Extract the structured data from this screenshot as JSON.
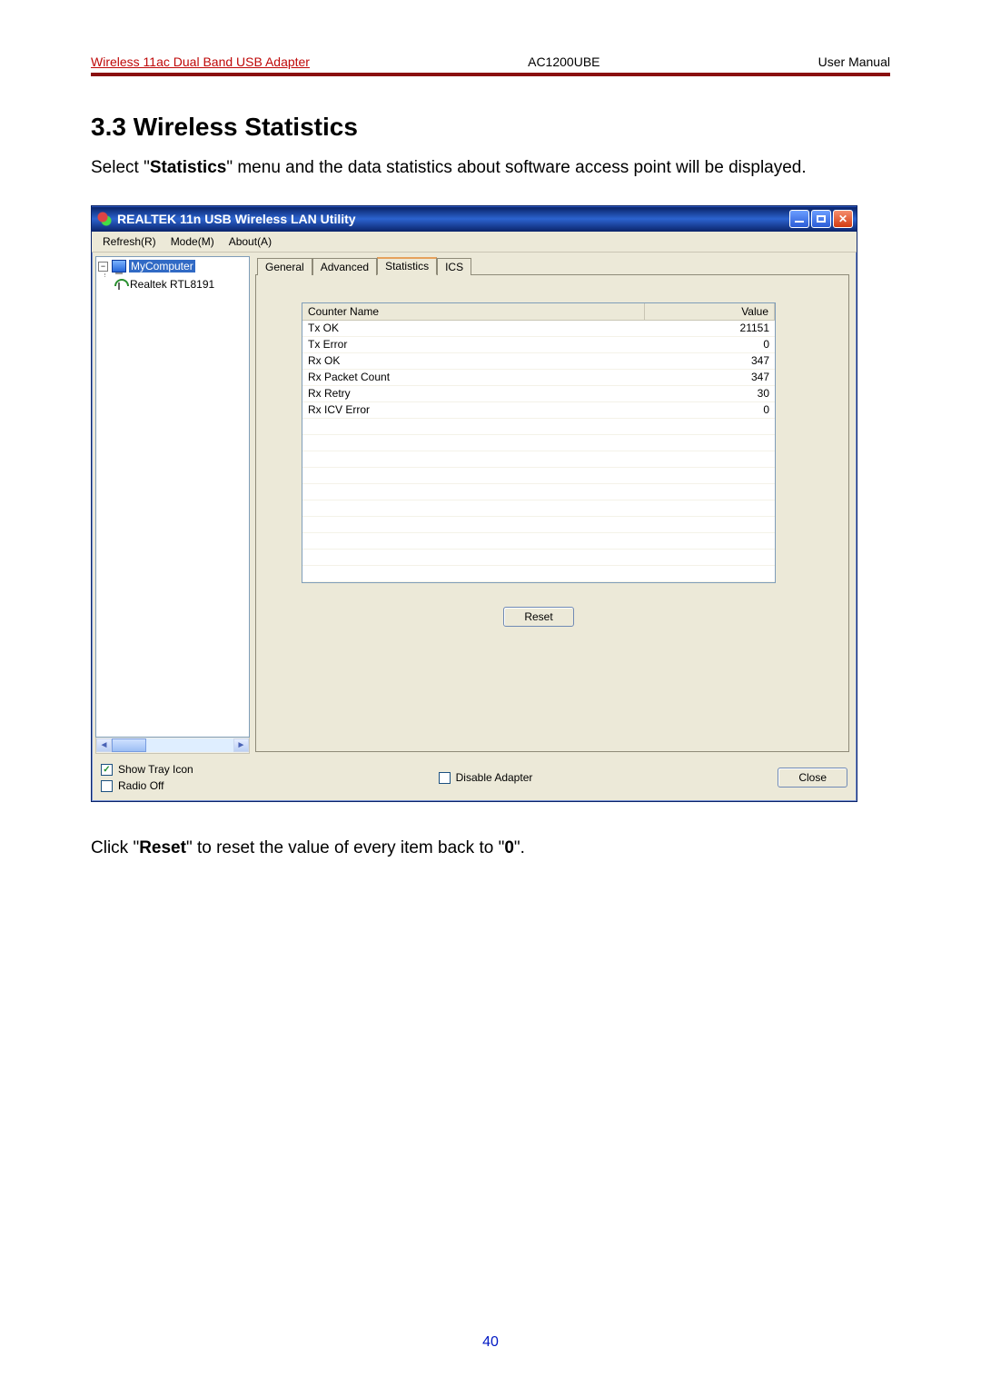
{
  "header": {
    "left": "Wireless 11ac Dual Band USB Adapter",
    "center": "AC1200UBE",
    "right": "User Manual"
  },
  "section_heading": "3.3 Wireless Statistics",
  "intro_parts": {
    "pre": "Select \"",
    "bold": "Statistics",
    "post": "\" menu and the data statistics about software access point will be displayed."
  },
  "outro_parts": {
    "pre": "Click \"",
    "bold1": "Reset",
    "mid": "\" to reset the value of every item back to \"",
    "bold2": "0",
    "post": "\"."
  },
  "window": {
    "title": "REALTEK 11n USB Wireless LAN Utility",
    "menus": [
      "Refresh(R)",
      "Mode(M)",
      "About(A)"
    ],
    "tree": {
      "root": "MyComputer",
      "child": "Realtek RTL8191"
    },
    "tabs": [
      "General",
      "Advanced",
      "Statistics",
      "ICS"
    ],
    "active_tab_index": 2,
    "list": {
      "headers": [
        "Counter Name",
        "Value"
      ],
      "rows": [
        {
          "name": "Tx OK",
          "value": "21151"
        },
        {
          "name": "Tx Error",
          "value": "0"
        },
        {
          "name": "Rx OK",
          "value": "347"
        },
        {
          "name": "Rx Packet Count",
          "value": "347"
        },
        {
          "name": "Rx Retry",
          "value": "30"
        },
        {
          "name": "Rx ICV Error",
          "value": "0"
        }
      ],
      "blank_rows": 10
    },
    "reset_label": "Reset",
    "checkboxes": {
      "show_tray": {
        "label": "Show Tray Icon",
        "checked": true
      },
      "radio_off": {
        "label": "Radio Off",
        "checked": false
      },
      "disable_adapter": {
        "label": "Disable Adapter",
        "checked": false
      }
    },
    "close_label": "Close"
  },
  "page_number": "40"
}
